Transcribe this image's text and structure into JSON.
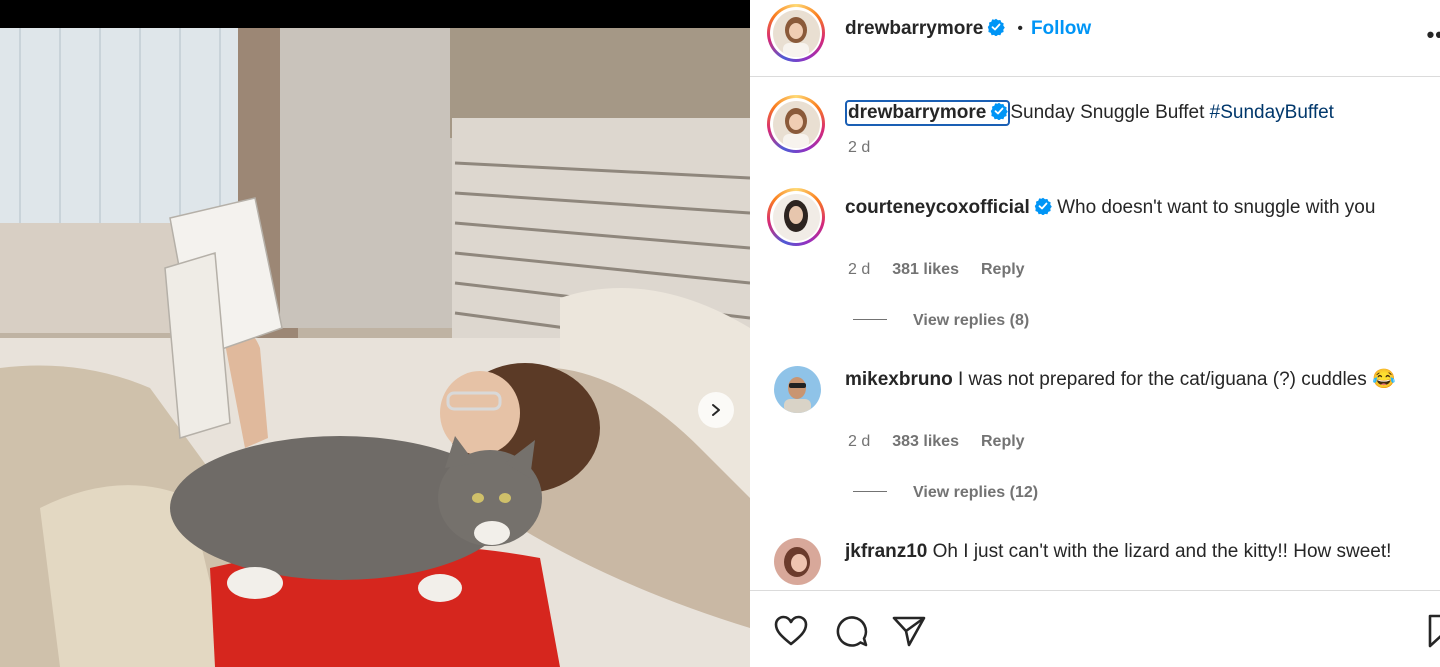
{
  "post": {
    "author": "drewbarrymore",
    "follow_label": "Follow",
    "separator": "•",
    "more_label": "••"
  },
  "caption": {
    "username": "drewbarrymore",
    "text": "Sunday Snuggle Buffet ",
    "hashtag": "#SundayBuffet",
    "time": "2 d"
  },
  "comments": [
    {
      "username": "courteneycoxofficial",
      "verified": true,
      "text": "Who doesn't want to snuggle with you",
      "time": "2 d",
      "likes": "381 likes",
      "reply": "Reply",
      "view_replies": "View replies (8)"
    },
    {
      "username": "mikexbruno",
      "verified": false,
      "text": "I was not prepared for the cat/iguana (?) cuddles 😂",
      "time": "2 d",
      "likes": "383 likes",
      "reply": "Reply",
      "view_replies": "View replies (12)"
    },
    {
      "username": "jkfranz10",
      "verified": false,
      "text": "Oh I just can't with the lizard and the kitty!! How sweet!"
    }
  ],
  "icons": [
    "heart-icon",
    "comment-icon",
    "share-icon",
    "save-icon",
    "verified-icon",
    "chevron-right-icon"
  ],
  "colors": {
    "link": "#0095f6",
    "hashtag": "#00376b",
    "verified": "#0095f6",
    "secondary_text": "#737373",
    "divider": "#dbdbdb"
  }
}
